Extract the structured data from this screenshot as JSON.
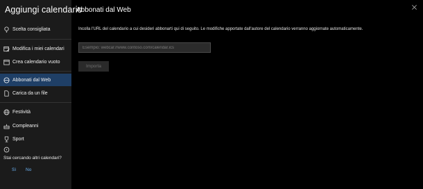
{
  "sidebar": {
    "title": "Aggiungi calendario",
    "items": [
      {
        "label": "Scelta consigliata",
        "icon": "lightbulb-icon"
      },
      {
        "label": "Modifica i miei calendari",
        "icon": "edit-calendar-icon"
      },
      {
        "label": "Crea calendario vuoto",
        "icon": "new-calendar-icon"
      },
      {
        "label": "Abbonati dal Web",
        "icon": "globe-icon",
        "active": true
      },
      {
        "label": "Carica da un file",
        "icon": "file-icon"
      },
      {
        "label": "Festività",
        "icon": "globe-icon"
      },
      {
        "label": "Compleanni",
        "icon": "cake-icon"
      },
      {
        "label": "Sport",
        "icon": "trophy-icon"
      }
    ],
    "help": {
      "text": "Stai cercando altri calendari?",
      "yes": "Sì",
      "no": "No"
    }
  },
  "main": {
    "title": "Abbonati dal Web",
    "instructions": "Incolla l'URL del calendario a cui desideri abbonarti qui di seguito. Le modifiche apportate dall'autore del calendario verranno aggiornate automaticamente.",
    "url_placeholder": "Esempio: webcal://www.contoso.com/calendar.ics",
    "url_value": "",
    "import_label": "Importa"
  },
  "colors": {
    "accent": "#1f3f66",
    "link": "#6cb4f5",
    "sidebar_bg": "#1b1b1b",
    "main_bg": "#000000"
  }
}
